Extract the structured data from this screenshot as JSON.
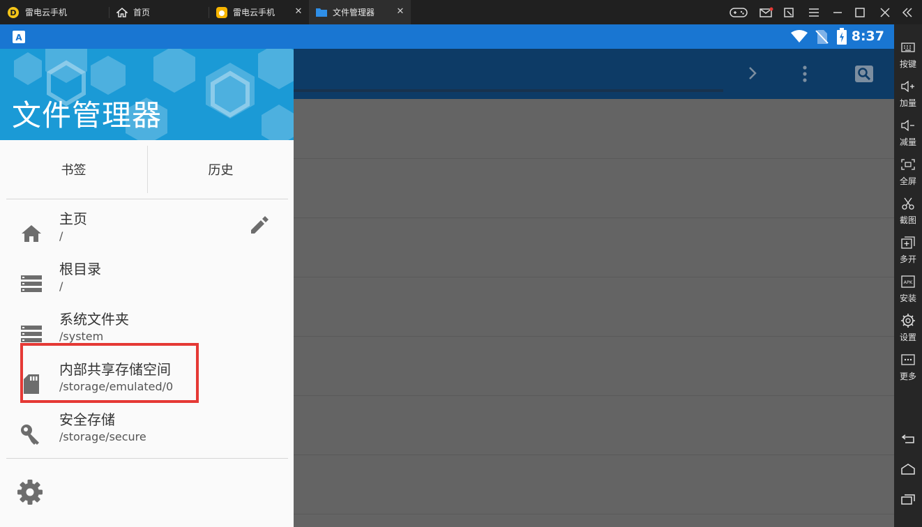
{
  "tabs": [
    {
      "label": "雷电云手机",
      "icon": "ldcloud-logo-icon"
    },
    {
      "label": "首页",
      "icon": "home-icon"
    },
    {
      "label": "雷电云手机",
      "icon": "ldcloud-app-icon"
    },
    {
      "label": "文件管理器",
      "icon": "folder-icon",
      "active": true
    }
  ],
  "statusbar": {
    "time": "8:37"
  },
  "drawer": {
    "title": "文件管理器",
    "segments": {
      "bookmarks": "书签",
      "history": "历史"
    },
    "items": [
      {
        "title": "主页",
        "path": "/",
        "icon": "home-icon"
      },
      {
        "title": "根目录",
        "path": "/",
        "icon": "storage-icon"
      },
      {
        "title": "系统文件夹",
        "path": "/system",
        "icon": "storage-icon"
      },
      {
        "title": "内部共享存储空间",
        "path": "/storage/emulated/0",
        "icon": "sd-card-icon",
        "highlighted": true
      },
      {
        "title": "安全存储",
        "path": "/storage/secure",
        "icon": "key-icon"
      }
    ]
  },
  "sidebar": {
    "buttons": [
      {
        "label": "按键",
        "icon": "keyboard-icon"
      },
      {
        "label": "加量",
        "icon": "volume-up-icon"
      },
      {
        "label": "减量",
        "icon": "volume-down-icon"
      },
      {
        "label": "全屏",
        "icon": "fullscreen-icon"
      },
      {
        "label": "截图",
        "icon": "scissors-icon"
      },
      {
        "label": "多开",
        "icon": "multi-open-icon"
      },
      {
        "label": "安装",
        "icon": "apk-install-icon"
      },
      {
        "label": "设置",
        "icon": "settings-icon"
      },
      {
        "label": "更多",
        "icon": "more-icon"
      }
    ]
  },
  "colors": {
    "statusbar": "#1976d2",
    "app_toolbar": "#0d3b66",
    "drawer_header": "#1b9ad6",
    "highlight": "#e53935",
    "scrim": "#646464"
  }
}
